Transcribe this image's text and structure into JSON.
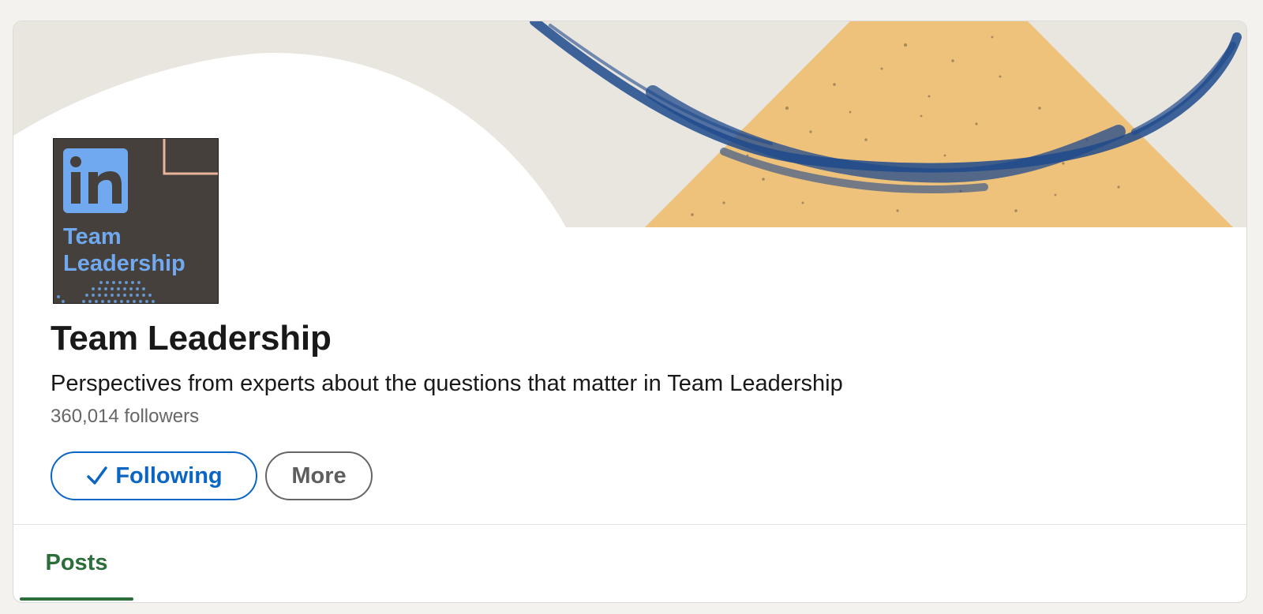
{
  "page": {
    "title": "Team Leadership",
    "tagline": "Perspectives from experts about the questions that matter in Team Leadership",
    "followers": "360,014 followers"
  },
  "logo": {
    "brand": "in",
    "line1": "Team",
    "line2": "Leadership",
    "icon": "linkedin-logo"
  },
  "actions": {
    "following_label": "Following",
    "following_icon": "check-icon",
    "more_label": "More"
  },
  "tabs": [
    {
      "label": "Posts",
      "active": true
    }
  ],
  "colors": {
    "accent_blue": "#0a66c2",
    "tab_green": "#2b6e3a",
    "cover_orange": "#efc27c",
    "cover_stroke": "#1f4a8c",
    "logo_bg": "#45403b",
    "logo_blue": "#70a9f0"
  }
}
